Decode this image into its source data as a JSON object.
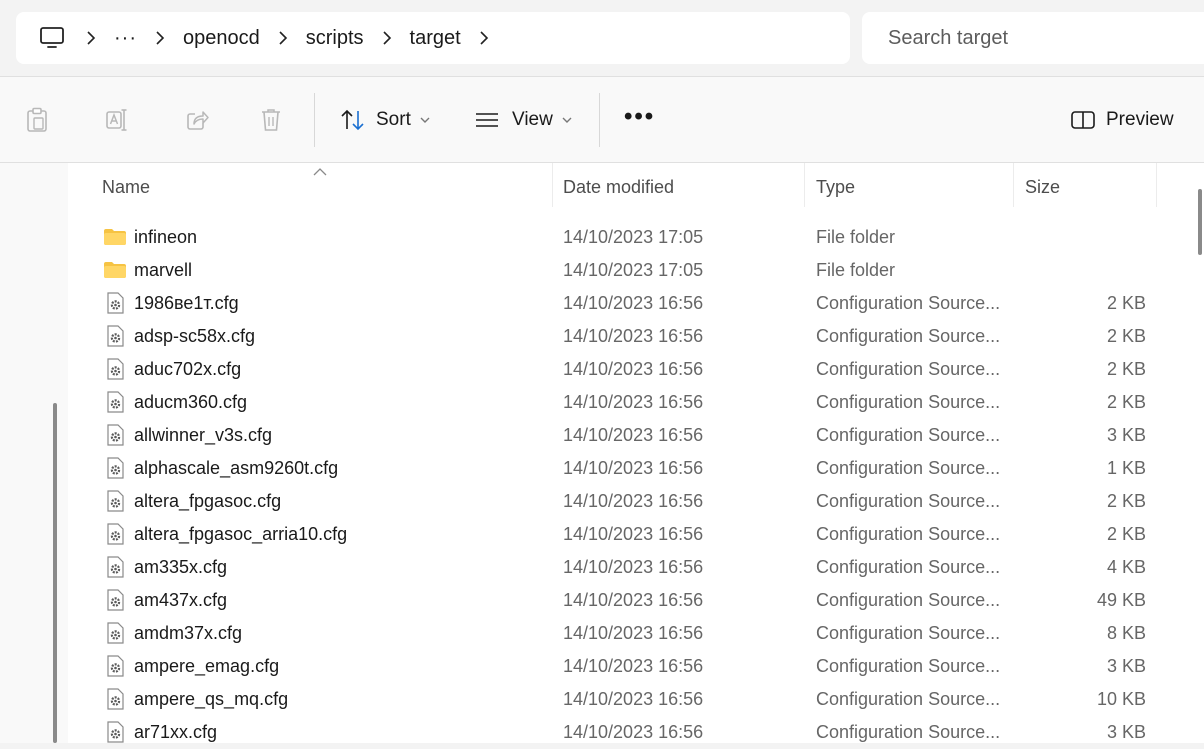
{
  "address": {
    "icon": "computer-icon",
    "ellipsis": "···",
    "crumbs": [
      "openocd",
      "scripts",
      "target"
    ]
  },
  "search": {
    "placeholder": "Search target"
  },
  "toolbar": {
    "sort_label": "Sort",
    "view_label": "View",
    "more_label": "•••",
    "preview_label": "Preview"
  },
  "columns": {
    "name": "Name",
    "date": "Date modified",
    "type": "Type",
    "size": "Size"
  },
  "files": [
    {
      "name": "infineon",
      "date": "14/10/2023 17:05",
      "type": "File folder",
      "size": "",
      "icon": "folder-icon"
    },
    {
      "name": "marvell",
      "date": "14/10/2023 17:05",
      "type": "File folder",
      "size": "",
      "icon": "folder-icon"
    },
    {
      "name": "1986ве1т.cfg",
      "date": "14/10/2023 16:56",
      "type": "Configuration Source...",
      "size": "2 KB",
      "icon": "config-file-icon"
    },
    {
      "name": "adsp-sc58x.cfg",
      "date": "14/10/2023 16:56",
      "type": "Configuration Source...",
      "size": "2 KB",
      "icon": "config-file-icon"
    },
    {
      "name": "aduc702x.cfg",
      "date": "14/10/2023 16:56",
      "type": "Configuration Source...",
      "size": "2 KB",
      "icon": "config-file-icon"
    },
    {
      "name": "aducm360.cfg",
      "date": "14/10/2023 16:56",
      "type": "Configuration Source...",
      "size": "2 KB",
      "icon": "config-file-icon"
    },
    {
      "name": "allwinner_v3s.cfg",
      "date": "14/10/2023 16:56",
      "type": "Configuration Source...",
      "size": "3 KB",
      "icon": "config-file-icon"
    },
    {
      "name": "alphascale_asm9260t.cfg",
      "date": "14/10/2023 16:56",
      "type": "Configuration Source...",
      "size": "1 KB",
      "icon": "config-file-icon"
    },
    {
      "name": "altera_fpgasoc.cfg",
      "date": "14/10/2023 16:56",
      "type": "Configuration Source...",
      "size": "2 KB",
      "icon": "config-file-icon"
    },
    {
      "name": "altera_fpgasoc_arria10.cfg",
      "date": "14/10/2023 16:56",
      "type": "Configuration Source...",
      "size": "2 KB",
      "icon": "config-file-icon"
    },
    {
      "name": "am335x.cfg",
      "date": "14/10/2023 16:56",
      "type": "Configuration Source...",
      "size": "4 KB",
      "icon": "config-file-icon"
    },
    {
      "name": "am437x.cfg",
      "date": "14/10/2023 16:56",
      "type": "Configuration Source...",
      "size": "49 KB",
      "icon": "config-file-icon"
    },
    {
      "name": "amdm37x.cfg",
      "date": "14/10/2023 16:56",
      "type": "Configuration Source...",
      "size": "8 KB",
      "icon": "config-file-icon"
    },
    {
      "name": "ampere_emag.cfg",
      "date": "14/10/2023 16:56",
      "type": "Configuration Source...",
      "size": "3 KB",
      "icon": "config-file-icon"
    },
    {
      "name": "ampere_qs_mq.cfg",
      "date": "14/10/2023 16:56",
      "type": "Configuration Source...",
      "size": "10 KB",
      "icon": "config-file-icon"
    },
    {
      "name": "ar71xx.cfg",
      "date": "14/10/2023 16:56",
      "type": "Configuration Source...",
      "size": "3 KB",
      "icon": "config-file-icon"
    }
  ],
  "colors": {
    "folder": "#f6c343",
    "icon_grey": "#9a9a9a",
    "text_secondary": "#666666"
  }
}
